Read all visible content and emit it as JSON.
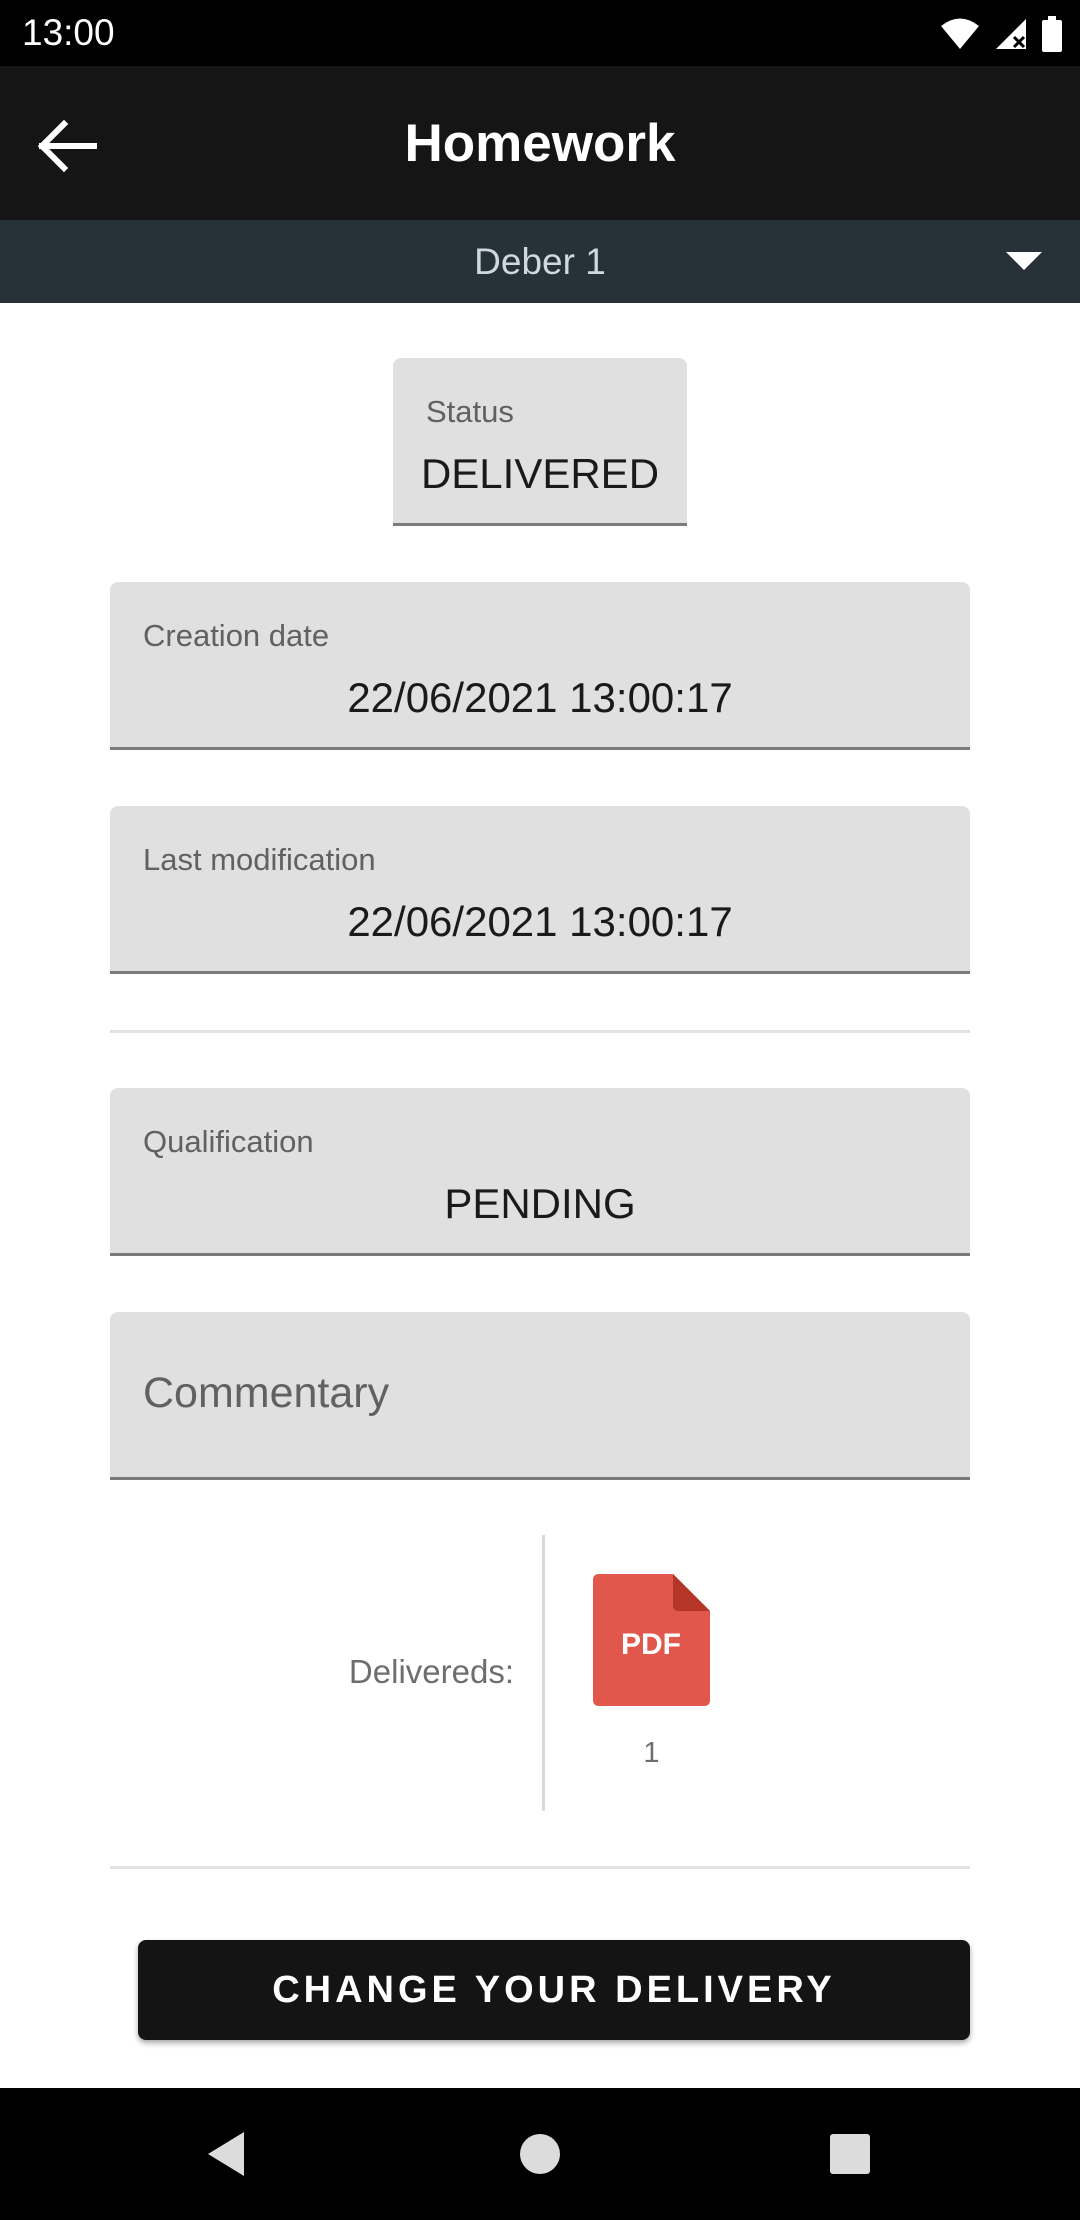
{
  "status_bar": {
    "time": "13:00",
    "icons": [
      "wifi-icon",
      "signal-icon",
      "battery-icon"
    ]
  },
  "app_bar": {
    "title": "Homework",
    "back_icon": "arrow-left-icon"
  },
  "selector": {
    "selected": "Deber 1",
    "caret_icon": "caret-down-icon"
  },
  "status_field": {
    "label": "Status",
    "value": "DELIVERED"
  },
  "creation_field": {
    "label": "Creation date",
    "value": "22/06/2021 13:00:17"
  },
  "modification_field": {
    "label": "Last modification",
    "value": "22/06/2021 13:00:17"
  },
  "qualification_field": {
    "label": "Qualification",
    "value": "PENDING"
  },
  "commentary_field": {
    "placeholder": "Commentary"
  },
  "delivered": {
    "label": "Delivereds:",
    "files": [
      {
        "type_label": "PDF",
        "number": "1"
      }
    ]
  },
  "change_button": {
    "label": "CHANGE YOUR DELIVERY"
  },
  "nav_bar": {
    "icons": [
      "back-triangle-icon",
      "home-circle-icon",
      "recents-square-icon"
    ]
  },
  "colors": {
    "app_bar": "#151515",
    "selector": "#263238",
    "field_bg": "#e0e0e0",
    "pdf_red": "#e2574c",
    "button": "#141414"
  }
}
